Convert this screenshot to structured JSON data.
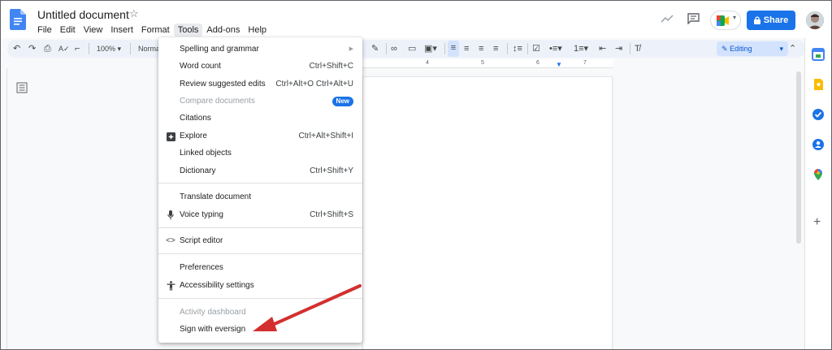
{
  "header": {
    "doc_title": "Untitled document",
    "menus": [
      "File",
      "Edit",
      "View",
      "Insert",
      "Format",
      "Tools",
      "Add-ons",
      "Help"
    ],
    "active_menu_index": 5,
    "share_label": "Share"
  },
  "toolbar": {
    "zoom": "100%",
    "style": "Normal",
    "mode": "Editing"
  },
  "ruler": {
    "ticks": [
      "4",
      "5",
      "6",
      "7"
    ]
  },
  "tools_menu": {
    "items": [
      {
        "label": "Spelling and grammar",
        "shortcut": "",
        "submenu": true,
        "disabled": false,
        "icon": ""
      },
      {
        "label": "Word count",
        "shortcut": "Ctrl+Shift+C",
        "disabled": false,
        "icon": ""
      },
      {
        "label": "Review suggested edits",
        "shortcut": "Ctrl+Alt+O Ctrl+Alt+U",
        "disabled": false,
        "icon": ""
      },
      {
        "label": "Compare documents",
        "shortcut": "",
        "badge": "New",
        "disabled": true,
        "icon": ""
      },
      {
        "label": "Citations",
        "shortcut": "",
        "disabled": false,
        "icon": ""
      },
      {
        "label": "Explore",
        "shortcut": "Ctrl+Alt+Shift+I",
        "disabled": false,
        "icon": "explore-icon"
      },
      {
        "label": "Linked objects",
        "shortcut": "",
        "disabled": false,
        "icon": ""
      },
      {
        "label": "Dictionary",
        "shortcut": "Ctrl+Shift+Y",
        "disabled": false,
        "icon": ""
      },
      {
        "label": "Translate document",
        "shortcut": "",
        "disabled": false,
        "icon": ""
      },
      {
        "label": "Voice typing",
        "shortcut": "Ctrl+Shift+S",
        "disabled": false,
        "icon": "microphone-icon"
      },
      {
        "label": "Script editor",
        "shortcut": "",
        "disabled": false,
        "icon": "code-icon"
      },
      {
        "label": "Preferences",
        "shortcut": "",
        "disabled": false,
        "icon": ""
      },
      {
        "label": "Accessibility settings",
        "shortcut": "",
        "disabled": false,
        "icon": "accessibility-icon"
      },
      {
        "label": "Activity dashboard",
        "shortcut": "",
        "disabled": true,
        "icon": ""
      },
      {
        "label": "Sign with eversign",
        "shortcut": "",
        "disabled": false,
        "icon": ""
      }
    ]
  },
  "colors": {
    "accent": "#1a73e8",
    "arrow": "#d32f2f",
    "editing_bg": "#d3e3fd"
  }
}
